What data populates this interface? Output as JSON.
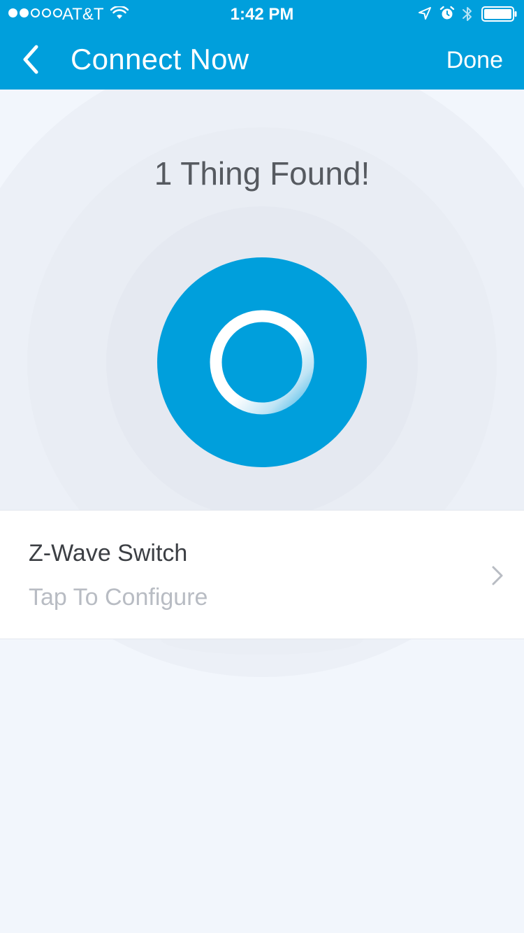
{
  "status_bar": {
    "carrier": "AT&T",
    "time": "1:42 PM",
    "signal_bars_filled": 2,
    "signal_bars_total": 5,
    "icons": [
      "wifi-icon",
      "location-arrow-icon",
      "alarm-icon",
      "bluetooth-icon",
      "battery-icon"
    ]
  },
  "nav": {
    "back_icon": "chevron-left-icon",
    "title": "Connect Now",
    "done_label": "Done"
  },
  "discovery": {
    "title": "1 Thing Found!",
    "center_icon": "spinner-ring-icon"
  },
  "devices": [
    {
      "name": "Z-Wave Switch",
      "subtitle": "Tap To Configure",
      "icon": "chevron-right-icon"
    }
  ],
  "colors": {
    "accent": "#009fdc",
    "background": "#f2f6fc",
    "title_text": "#565a60",
    "subtitle_text": "#b8bcc3"
  }
}
